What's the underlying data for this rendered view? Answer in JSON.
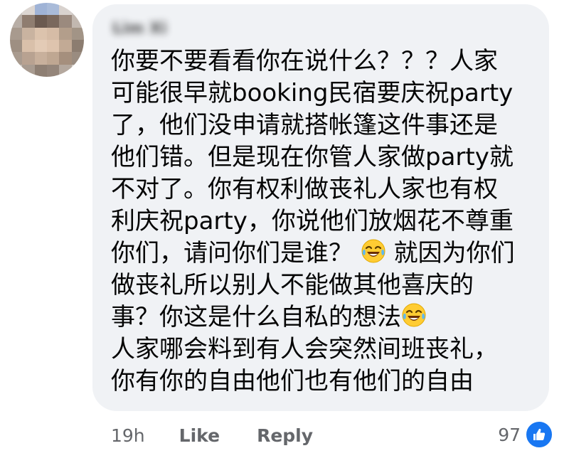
{
  "comment": {
    "author": "Lim Xi",
    "lines": [
      "你要不要看看你在说什么？？？人家",
      "可能很早就booking民宿要庆祝party",
      "了，他们没申请就搭帐篷这件事还是",
      "他们错。但是现在你管人家做party就",
      "不对了。你有权利做丧礼人家也有权",
      "利庆祝party，你说他们放烟花不尊重",
      "你们，请问你们是谁？",
      "就因为你们",
      "做丧礼所以别人不能做其他喜庆的",
      "事？你这是什么自私的想法",
      "人家哪会料到有人会突然间班丧礼，",
      "你有你的自由他们也有他们的自由"
    ]
  },
  "footer": {
    "time": "19h",
    "like_label": "Like",
    "reply_label": "Reply",
    "reaction_count": "97"
  },
  "icons": {
    "emoji": "face-with-tears-of-joy-icon",
    "reaction": "thumbs-up-icon"
  },
  "colors": {
    "bubble": "#f0f2f5",
    "meta_text": "#65676b",
    "like_blue": "#1877f2"
  }
}
